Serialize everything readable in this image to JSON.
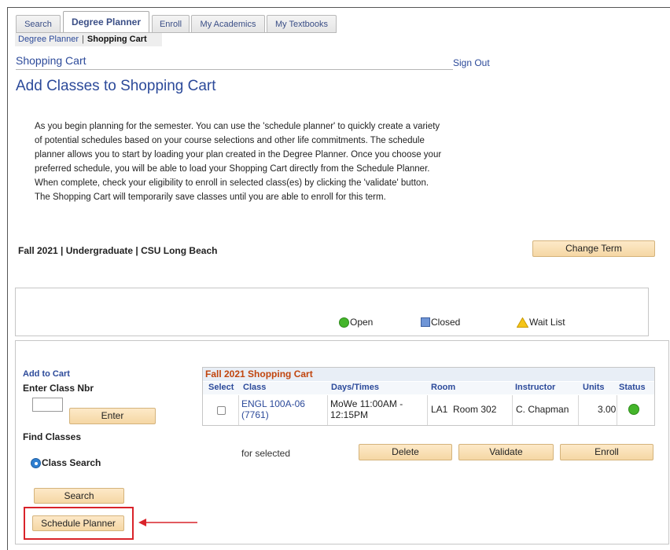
{
  "tabs": [
    {
      "label": "Search",
      "active": false
    },
    {
      "label": "Degree Planner",
      "active": true
    },
    {
      "label": "Enroll",
      "active": false
    },
    {
      "label": "My Academics",
      "active": false
    },
    {
      "label": "My Textbooks",
      "active": false
    }
  ],
  "breadcrumb": {
    "link": "Degree Planner",
    "separator": "|",
    "current": "Shopping Cart"
  },
  "header": {
    "section_title": "Shopping Cart",
    "sign_out": "Sign Out",
    "page_title": "Add Classes to Shopping Cart"
  },
  "instructions": "As you begin planning for the semester.  You can use the 'schedule planner' to quickly create a variety of potential schedules based on your course selections and other life commitments. The schedule planner allows you to start by loading your plan created in the Degree Planner. Once you choose your preferred schedule, you will be able to load your Shopping Cart directly from the Schedule Planner. When complete, check your eligibility to enroll in selected class(es) by clicking the 'validate' button. The Shopping Cart will temporarily save classes until you are able to enroll for this term.",
  "term": {
    "text": "Fall 2021 | Undergraduate | CSU Long Beach",
    "change_button": "Change Term"
  },
  "legend": {
    "open": "Open",
    "closed": "Closed",
    "wait_list": "Wait List",
    "colors": {
      "open": "#44b52a",
      "closed": "#6f95d6",
      "wait_list": "#f5c518"
    }
  },
  "add_to_cart": {
    "heading": "Add to Cart",
    "enter_class_label": "Enter Class Nbr",
    "class_nbr_value": "",
    "enter_button": "Enter",
    "find_classes_label": "Find Classes",
    "class_search_option": "Class Search",
    "search_button": "Search",
    "schedule_planner_button": "Schedule Planner",
    "highlight_color": "#d9232a"
  },
  "cart": {
    "title": "Fall 2021 Shopping Cart",
    "columns": [
      "Select",
      "Class",
      "Days/Times",
      "Room",
      "Instructor",
      "Units",
      "Status"
    ],
    "rows": [
      {
        "class_line1": "ENGL 100A-06",
        "class_line2": "(7761)",
        "days_line1": "MoWe 11:00AM -",
        "days_line2": "12:15PM",
        "room": "LA1  Room 302",
        "instructor": "C. Chapman",
        "units": "3.00",
        "status": "open"
      }
    ],
    "for_selected": "for selected",
    "buttons": {
      "delete": "Delete",
      "validate": "Validate",
      "enroll": "Enroll"
    }
  }
}
